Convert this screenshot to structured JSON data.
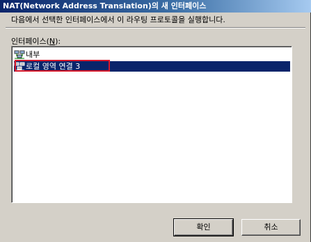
{
  "window": {
    "title": "NAT(Network Address Translation)의 새 인터페이스"
  },
  "instruction": "다음에서 선택한 인터페이스에서 이 라우팅 프로토콜을 실행합니다.",
  "interfaces_label": {
    "prefix": "인터페이스(",
    "accel": "N",
    "suffix": "):"
  },
  "interfaces": [
    {
      "label": "내부",
      "icon": "network-adapter-icon",
      "selected": false
    },
    {
      "label": "로컬 영역 연결 3",
      "icon": "network-adapter-icon",
      "selected": true
    }
  ],
  "buttons": {
    "ok": "확인",
    "cancel": "취소"
  },
  "colors": {
    "selection": "#0a246a",
    "annotation_box": "#d8182a"
  }
}
